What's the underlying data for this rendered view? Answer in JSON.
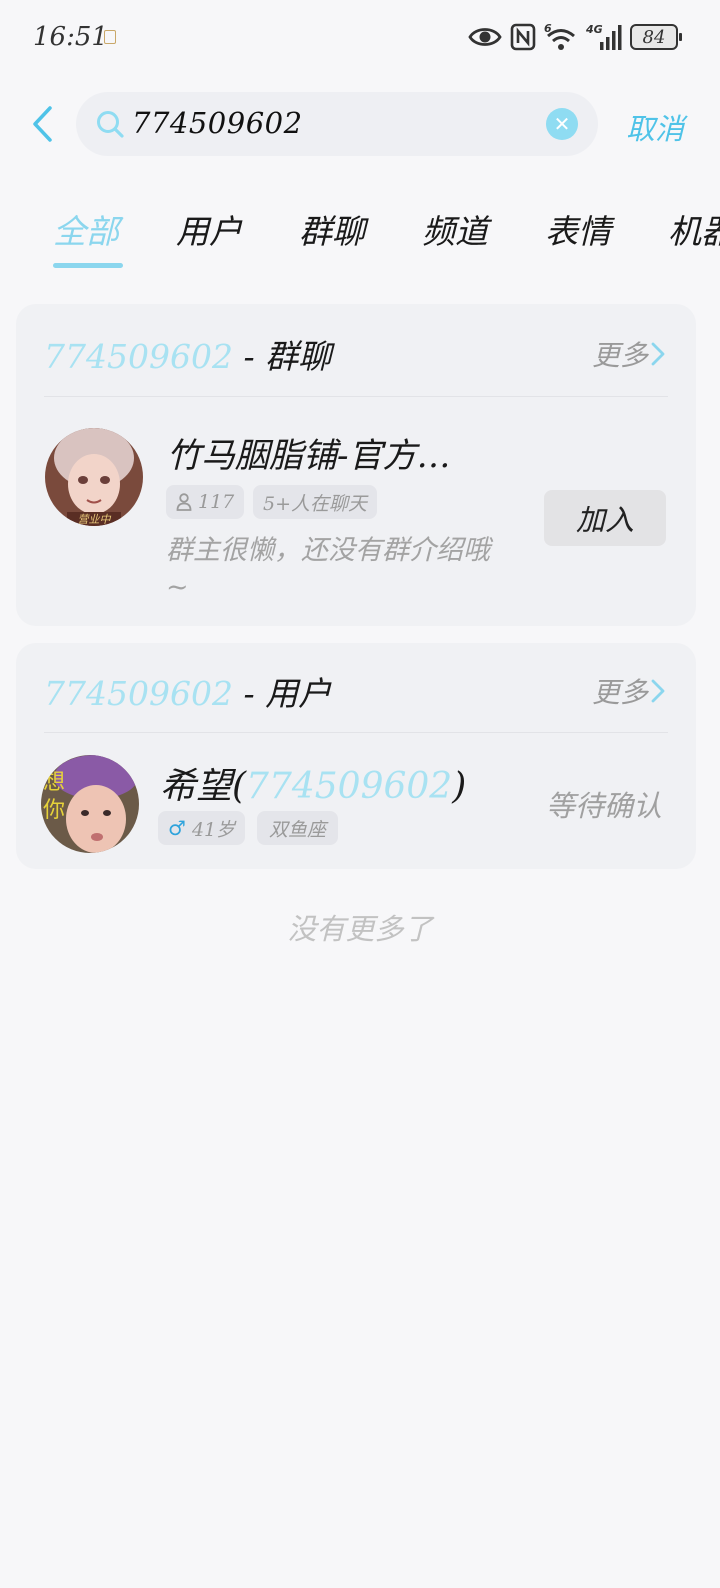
{
  "status_bar": {
    "time": "16:51",
    "network": "4G",
    "wifi_badge": "6",
    "battery": "84"
  },
  "search": {
    "query": "774509602",
    "cancel_label": "取消"
  },
  "tabs": [
    {
      "label": "全部",
      "active": true
    },
    {
      "label": "用户",
      "active": false
    },
    {
      "label": "群聊",
      "active": false
    },
    {
      "label": "频道",
      "active": false
    },
    {
      "label": "表情",
      "active": false
    },
    {
      "label": "机器",
      "active": false
    }
  ],
  "group_section": {
    "title_num": "774509602",
    "title_suffix": " - 群聊",
    "more_label": "更多",
    "item": {
      "name": "竹马胭脂铺-官方…",
      "member_count": "117",
      "active_label": "5+人在聊天",
      "description": "群主很懒，还没有群介绍哦~",
      "join_label": "加入"
    }
  },
  "user_section": {
    "title_num": "774509602",
    "title_suffix": " - 用户",
    "more_label": "更多",
    "item": {
      "name_prefix": "希望(",
      "name_num": "774509602",
      "name_suffix": ")",
      "gender_symbol": "♂",
      "age": "41岁",
      "zodiac": "双鱼座",
      "status": "等待确认",
      "avatar_overlay_text": "想你"
    }
  },
  "footer": {
    "no_more": "没有更多了"
  },
  "colors": {
    "accent": "#4fc3e8",
    "accent_light": "#8bd6ee",
    "background": "#f7f7f9",
    "card": "#f0f1f4"
  },
  "icons": {
    "back": "chevron-left-icon",
    "search": "search-icon",
    "clear": "clear-icon",
    "more": "chevron-right-icon",
    "members": "person-icon"
  }
}
